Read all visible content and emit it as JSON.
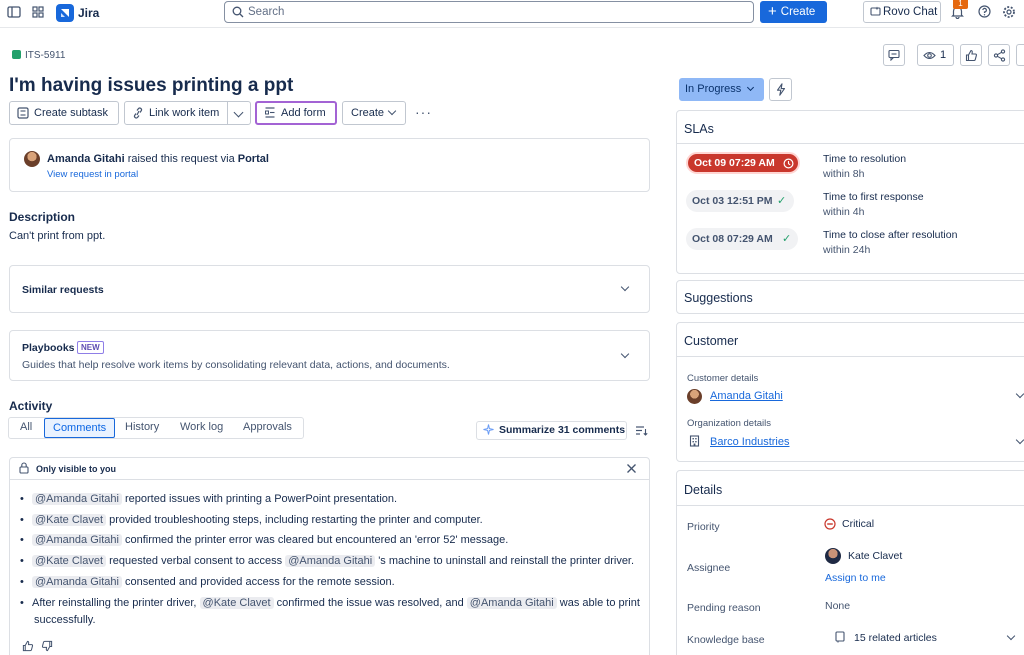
{
  "topbar": {
    "app_name": "Jira",
    "search_placeholder": "Search",
    "create_label": "Create",
    "rovo_label": "Rovo Chat",
    "notification_count": "1"
  },
  "issue": {
    "key": "ITS-5911",
    "title": "I'm having issues printing a ppt",
    "watch_count": "1",
    "actions": {
      "create_subtask": "Create subtask",
      "link_work_item": "Link work item",
      "add_form": "Add form",
      "create": "Create"
    }
  },
  "request": {
    "reporter": "Amanda Gitahi",
    "raised_text": "raised this request via",
    "channel": "Portal",
    "view_link": "View request in portal"
  },
  "description": {
    "heading": "Description",
    "text": "Can't print from ppt."
  },
  "similar": {
    "label": "Similar requests"
  },
  "playbooks": {
    "label": "Playbooks",
    "badge": "NEW",
    "text": "Guides that help resolve work items by consolidating relevant data, actions, and documents."
  },
  "activity": {
    "heading": "Activity",
    "tabs": [
      "All",
      "Comments",
      "History",
      "Work log",
      "Approvals"
    ],
    "summarize_label": "Summarize 31 comments",
    "visibility_label": "Only visible to you",
    "summary": [
      {
        "mention": "@Amanda Gitahi",
        "text": "reported issues with printing a PowerPoint presentation."
      },
      {
        "mention": "@Kate Clavet",
        "text": "provided troubleshooting steps, including restarting the printer and computer."
      },
      {
        "mention": "@Amanda Gitahi",
        "text": "confirmed the printer error was cleared but encountered an 'error 52' message."
      },
      {
        "mention": "@Kate Clavet",
        "text": "requested verbal consent to access",
        "mention2": "@Amanda Gitahi",
        "text2": "'s machine to uninstall and reinstall the printer driver."
      },
      {
        "mention": "@Amanda Gitahi",
        "text": "consented and provided access for the remote session."
      },
      {
        "prefix": "After reinstalling the printer driver,",
        "mention": "@Kate Clavet",
        "text": "confirmed the issue was resolved, and",
        "mention2": "@Amanda Gitahi",
        "text2": "was able to print",
        "line2": "successfully."
      }
    ]
  },
  "status": {
    "label": "In Progress"
  },
  "slas": {
    "heading": "SLAs",
    "items": [
      {
        "time": "Oct 09 07:29 AM",
        "name": "Time to resolution",
        "target": "within 8h",
        "state": "breached"
      },
      {
        "time": "Oct 03 12:51 PM",
        "name": "Time to first response",
        "target": "within 4h",
        "state": "met"
      },
      {
        "time": "Oct 08 07:29 AM",
        "name": "Time to close after resolution",
        "target": "within 24h",
        "state": "met"
      }
    ]
  },
  "suggestions": {
    "heading": "Suggestions"
  },
  "customer": {
    "heading": "Customer",
    "customer_label": "Customer details",
    "customer_name": "Amanda Gitahi",
    "org_label": "Organization details",
    "org_name": "Barco Industries"
  },
  "details": {
    "heading": "Details",
    "priority_label": "Priority",
    "priority_value": "Critical",
    "assignee_label": "Assignee",
    "assignee_value": "Kate Clavet",
    "assign_to_me": "Assign to me",
    "pending_label": "Pending reason",
    "pending_value": "None",
    "kb_label": "Knowledge base",
    "kb_value": "15 related articles"
  },
  "colors": {
    "brand": "#1868db",
    "breach": "#c9372c",
    "status": "#8fb8f6",
    "focus": "#a363d4"
  }
}
